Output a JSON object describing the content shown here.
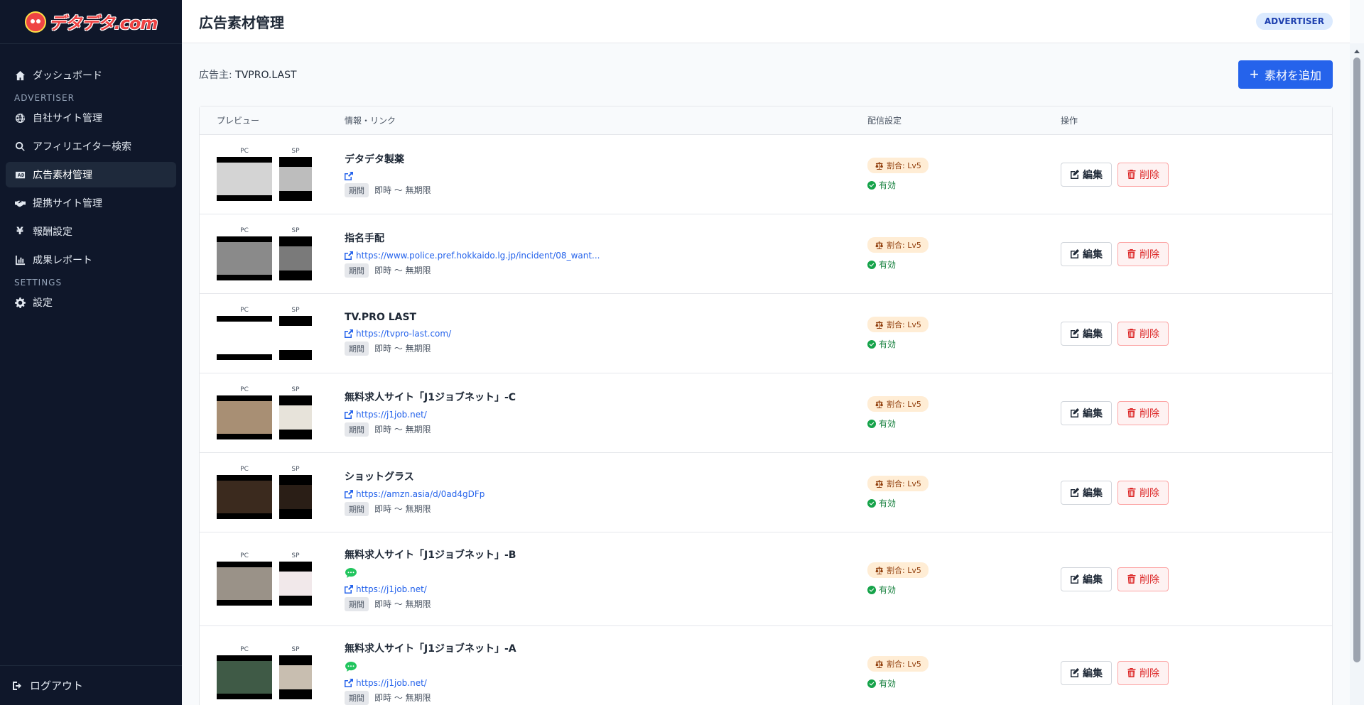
{
  "app": {
    "logo_text": "デタデタ.com"
  },
  "sidebar": {
    "items": [
      {
        "label": "ダッシュボード",
        "icon": "home-icon"
      },
      {
        "section": "ADVERTISER"
      },
      {
        "label": "自社サイト管理",
        "icon": "globe-icon"
      },
      {
        "label": "アフィリエイター検索",
        "icon": "search-icon"
      },
      {
        "label": "広告素材管理",
        "icon": "ad-icon",
        "active": true
      },
      {
        "label": "提携サイト管理",
        "icon": "handshake-icon"
      },
      {
        "label": "報酬設定",
        "icon": "yen-icon"
      },
      {
        "label": "成果レポート",
        "icon": "chart-icon"
      },
      {
        "section": "SETTINGS"
      },
      {
        "label": "設定",
        "icon": "gear-icon"
      }
    ],
    "logout_label": "ログアウト"
  },
  "header": {
    "title": "広告素材管理",
    "role": "ADVERTISER"
  },
  "toolbar": {
    "advertiser_label": "広告主:",
    "advertiser_name": "TVPRO.LAST",
    "add_button": "素材を追加"
  },
  "table": {
    "headers": {
      "preview": "プレビュー",
      "info": "情報・リンク",
      "distribution": "配信設定",
      "ops": "操作"
    },
    "thumb_labels": {
      "pc": "PC",
      "sp": "SP"
    },
    "period_tag": "期間",
    "edit_label": "編集",
    "delete_label": "削除",
    "rows": [
      {
        "title": "デタデタ製薬",
        "url": "",
        "chat": false,
        "period": "即時 〜 無期限",
        "ratio": "割合: Lv5",
        "status": "有効",
        "pc_color": "#d4d4d4",
        "sp_color": "#bdbdbd"
      },
      {
        "title": "指名手配",
        "url": "https://www.police.pref.hokkaido.lg.jp/incident/08_want...",
        "chat": false,
        "period": "即時 〜 無期限",
        "ratio": "割合: Lv5",
        "status": "有効",
        "pc_color": "#8a8a8a",
        "sp_color": "#7a7a7a"
      },
      {
        "title": "TV.PRO LAST",
        "url": "https://tvpro-last.com/",
        "chat": false,
        "period": "即時 〜 無期限",
        "ratio": "割合: Lv5",
        "status": "有効",
        "pc_color": "#ffffff",
        "sp_color": "#ffffff"
      },
      {
        "title": "無料求人サイト「J1ジョブネット」-C",
        "url": "https://j1job.net/",
        "chat": false,
        "period": "即時 〜 無期限",
        "ratio": "割合: Lv5",
        "status": "有効",
        "pc_color": "#a88f74",
        "sp_color": "#e7e3da"
      },
      {
        "title": "ショットグラス",
        "url": "https://amzn.asia/d/0ad4gDFp",
        "chat": false,
        "period": "即時 〜 無期限",
        "ratio": "割合: Lv5",
        "status": "有効",
        "pc_color": "#3b2a1e",
        "sp_color": "#2a1e16"
      },
      {
        "title": "無料求人サイト「J1ジョブネット」-B",
        "url": "https://j1job.net/",
        "chat": true,
        "period": "即時 〜 無期限",
        "ratio": "割合: Lv5",
        "status": "有効",
        "pc_color": "#9a9288",
        "sp_color": "#f1e8ea"
      },
      {
        "title": "無料求人サイト「J1ジョブネット」-A",
        "url": "https://j1job.net/",
        "chat": true,
        "period": "即時 〜 無期限",
        "ratio": "割合: Lv5",
        "status": "有効",
        "pc_color": "#3f5a46",
        "sp_color": "#c8beb0"
      }
    ]
  },
  "colors": {
    "sidebar_bg": "#0f172a",
    "primary": "#2563eb",
    "danger": "#dc2626",
    "success": "#16a34a",
    "ratio_bg": "#ffedd5"
  }
}
